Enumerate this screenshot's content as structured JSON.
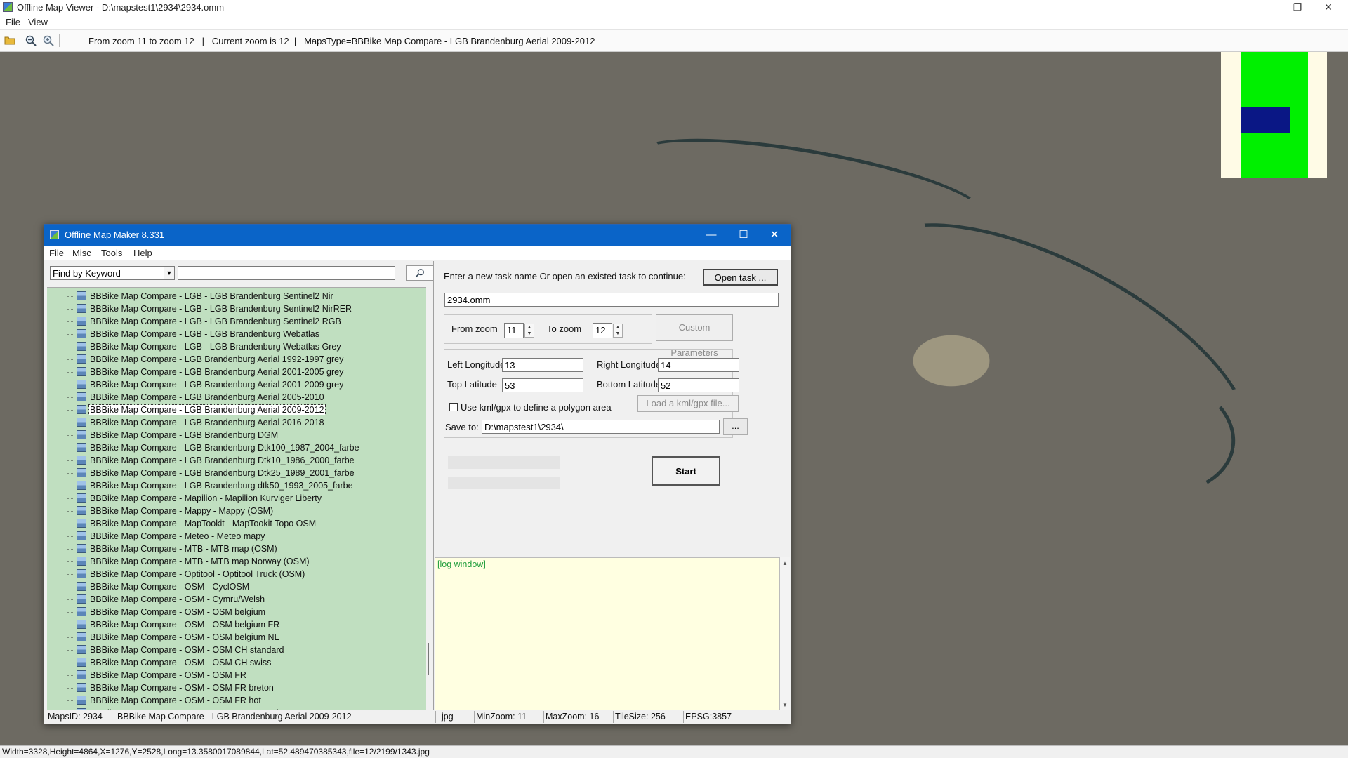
{
  "viewer": {
    "title": "Offline Map Viewer - D:\\mapstest1\\2934\\2934.omm",
    "menu": [
      "File",
      "View"
    ],
    "toolbar_info": "From zoom 11 to zoom 12   |   Current zoom is 12  |   MapsType=BBBike Map Compare - LGB Brandenburg Aerial 2009-2012",
    "status": "Width=3328,Height=4864,X=1276,Y=2528,Long=13.3580017089844,Lat=52.489470385343,file=12/2199/1343.jpg",
    "window_controls": [
      "—",
      "❐",
      "✕"
    ]
  },
  "dialog": {
    "title": "Offline Map Maker 8.331",
    "menu": [
      "File",
      "Misc",
      "Tools",
      "Help"
    ],
    "search_type": "Find by Keyword",
    "search_value": "",
    "tree_items": [
      "BBBike Map Compare - LGB - LGB Brandenburg Sentinel2 Nir",
      "BBBike Map Compare - LGB - LGB Brandenburg Sentinel2 NirRER",
      "BBBike Map Compare - LGB - LGB Brandenburg Sentinel2 RGB",
      "BBBike Map Compare - LGB - LGB Brandenburg Webatlas",
      "BBBike Map Compare - LGB - LGB Brandenburg Webatlas Grey",
      "BBBike Map Compare - LGB Brandenburg Aerial 1992-1997 grey",
      "BBBike Map Compare - LGB Brandenburg Aerial 2001-2005 grey",
      "BBBike Map Compare - LGB Brandenburg Aerial 2001-2009 grey",
      "BBBike Map Compare - LGB Brandenburg Aerial 2005-2010",
      "BBBike Map Compare - LGB Brandenburg Aerial 2009-2012",
      "BBBike Map Compare - LGB Brandenburg Aerial 2016-2018",
      "BBBike Map Compare - LGB Brandenburg DGM",
      "BBBike Map Compare - LGB Brandenburg Dtk100_1987_2004_farbe",
      "BBBike Map Compare - LGB Brandenburg Dtk10_1986_2000_farbe",
      "BBBike Map Compare - LGB Brandenburg Dtk25_1989_2001_farbe",
      "BBBike Map Compare - LGB Brandenburg dtk50_1993_2005_farbe",
      "BBBike Map Compare - Mapilion - Mapilion Kurviger Liberty",
      "BBBike Map Compare - Mappy - Mappy (OSM)",
      "BBBike Map Compare - MapTookit - MapTookit Topo OSM",
      "BBBike Map Compare - Meteo - Meteo mapy",
      "BBBike Map Compare - MTB - MTB map (OSM)",
      "BBBike Map Compare - MTB - MTB map Norway (OSM)",
      "BBBike Map Compare - Optitool - Optitool Truck (OSM)",
      "BBBike Map Compare - OSM - CyclOSM",
      "BBBike Map Compare - OSM - Cymru/Welsh",
      "BBBike Map Compare - OSM - OSM belgium",
      "BBBike Map Compare - OSM - OSM belgium FR",
      "BBBike Map Compare - OSM - OSM belgium NL",
      "BBBike Map Compare - OSM - OSM CH standard",
      "BBBike Map Compare - OSM - OSM CH swiss",
      "BBBike Map Compare - OSM - OSM FR",
      "BBBike Map Compare - OSM - OSM FR breton",
      "BBBike Map Compare - OSM - OSM FR hot",
      "BBBike Map Compare - OSM - OSM FR OpenRiverBoatMap"
    ],
    "selected_item": "BBBike Map Compare - LGB Brandenburg Aerial 2009-2012",
    "task_prompt": "Enter a new task name Or open an existed task to continue:",
    "open_task_label": "Open task ...",
    "task_name": "2934.omm",
    "from_zoom_label": "From zoom",
    "from_zoom": "11",
    "to_zoom_label": "To zoom",
    "to_zoom": "12",
    "custom_params_label": "Custom Parameters",
    "left_lon_label": "Left Longitude",
    "left_lon": "13",
    "right_lon_label": "Right Longitude",
    "right_lon": "14",
    "top_lat_label": "Top Latitude",
    "top_lat": "53",
    "bottom_lat_label": "Bottom Latitude",
    "bottom_lat": "52",
    "kml_checkbox_label": "Use kml/gpx to define a polygon area",
    "kml_checked": false,
    "load_kml_label": "Load a kml/gpx file...",
    "save_to_label": "Save to:",
    "save_to": "D:\\mapstest1\\2934\\",
    "browse_label": "...",
    "start_label": "Start",
    "log_text": "[log window]",
    "status": {
      "maps_id": "MapsID: 2934",
      "map_name": "BBBike Map Compare - LGB Brandenburg Aerial 2009-2012",
      "format": "jpg",
      "min_zoom": "MinZoom: 11",
      "max_zoom": "MaxZoom: 16",
      "tile_size": "TileSize: 256",
      "epsg": "EPSG:3857"
    },
    "window_controls": [
      "—",
      "☐",
      "✕"
    ]
  },
  "colors": {
    "dialog_title": "#0a64c8",
    "tree_bg": "#c0dfc0",
    "log_bg": "#ffffe1",
    "minimap_green": "#00f000",
    "minimap_view": "#0a1785"
  },
  "icons": [
    "open-folder-icon",
    "zoom-out-icon",
    "zoom-in-icon",
    "search-icon",
    "map-layer-icon"
  ]
}
